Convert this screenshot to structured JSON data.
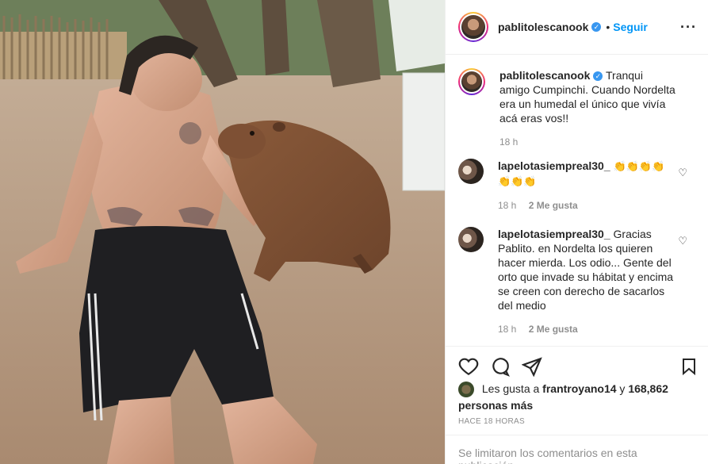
{
  "post": {
    "author": {
      "username": "pablitolescanook",
      "verified": true
    },
    "header": {
      "separator": "•",
      "follow_label": "Seguir"
    },
    "caption": {
      "text": "Tranqui amigo Cumpinchi. Cuando Nordelta era un humedal el único que vivía acá eras vos!!",
      "time": "18 h"
    },
    "comments": [
      {
        "username": "lapelotasiempreal30_",
        "text": "👏👏👏👏👏👏👏",
        "time": "18 h",
        "likes": "2 Me gusta"
      },
      {
        "username": "lapelotasiempreal30_",
        "text": "Gracias Pablito. en Nordelta los quieren hacer mierda. Los odio... Gente del orto que invade su hábitat y encima se creen con derecho de sacarlos del medio",
        "time": "18 h",
        "likes": "2 Me gusta"
      }
    ],
    "likes": {
      "prefix": "Les gusta a",
      "first_user": "frantroyano14",
      "connector": "y",
      "others": "168,862 personas más"
    },
    "time_ago": "HACE 18 HORAS",
    "footer_text": "Se limitaron los comentarios en esta publicación.",
    "icons": {
      "more": "more-options-icon",
      "like": "heart-icon",
      "comment": "comment-icon",
      "share": "paper-plane-icon",
      "save": "bookmark-icon",
      "verified": "verified-badge-icon"
    },
    "colors": {
      "link_blue": "#0095f6",
      "verified": "#3897f0",
      "muted": "#8e8e8e",
      "text": "#262626",
      "border": "#efefef"
    }
  }
}
